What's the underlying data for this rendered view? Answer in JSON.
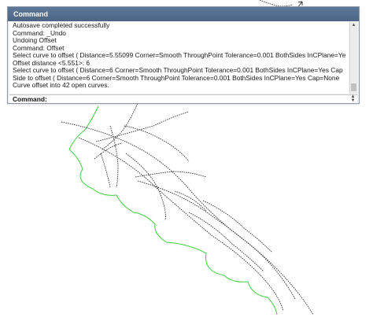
{
  "command_window": {
    "title": "Command",
    "history": [
      "Autosave completed successfully",
      "Command: _Undo",
      "Undoing Offset",
      "Command: Offset",
      "Select curve to offset ( Distance=5.55099  Corner=Smooth  ThroughPoint  Tolerance=0.001  BothSides  InCPlane=Ye",
      "Offset distance <5.551>: 6",
      "Select curve to offset ( Distance=6  Corner=Smooth  ThroughPoint  Tolerance=0.001  BothSides  InCPlane=Yes  Cap",
      "Side to offset ( Distance=6  Corner=Smooth  ThroughPoint  Tolerance=0.001  BothSides  InCPlane=Yes  Cap=None",
      "Curve offset into 42 open curves."
    ],
    "prompt_label": "Command:",
    "prompt_value": "",
    "scroll_up_icon": "arrow-up",
    "scroll_down_icon": "arrow-down",
    "spin_icon": "spin-updown"
  },
  "viewport": {
    "background": "#ffffff",
    "green_curve_color": "#3ecf3e",
    "curve_color": "#2a2a2a"
  }
}
